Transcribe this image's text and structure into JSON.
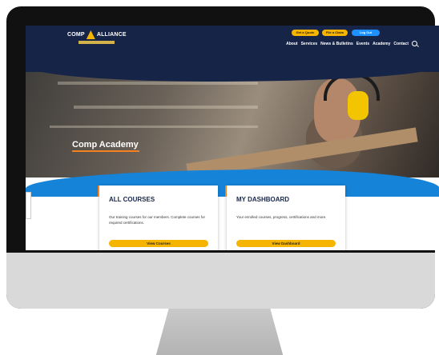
{
  "header": {
    "logo_left": "COMP",
    "logo_right": "ALLIANCE",
    "buttons": [
      {
        "label": "Get a Quote",
        "color": "#f5b400"
      },
      {
        "label": "File a Claim",
        "color": "#f5b400"
      },
      {
        "label": "Log Out",
        "color": "#1e90ff"
      }
    ],
    "nav": [
      "About",
      "Services",
      "News & Bulletins",
      "Events",
      "Academy",
      "Contact"
    ]
  },
  "hero": {
    "title": "Comp Academy"
  },
  "cards": [
    {
      "title": "ALL COURSES",
      "description": "Our training courses for our members. Complete courses for required certifications.",
      "button": "View Courses"
    },
    {
      "title": "MY DASHBOARD",
      "description": "Your enrolled courses, progress, certifications and more.",
      "button": "View Dashboard"
    }
  ],
  "colors": {
    "navy": "#162447",
    "accent_orange": "#f58220",
    "blue": "#1583d8",
    "yellow": "#f5b400"
  }
}
